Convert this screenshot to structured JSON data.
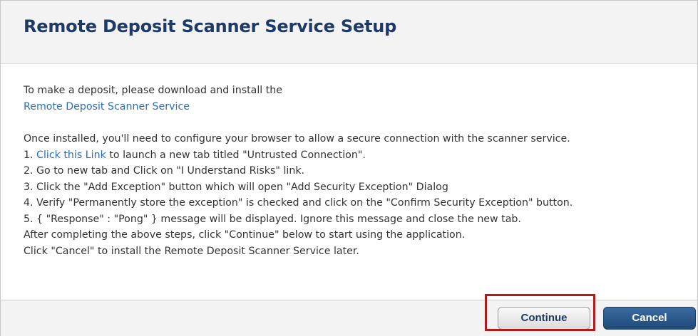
{
  "dialog": {
    "title": "Remote Deposit Scanner Service Setup",
    "intro_line": "To make a deposit, please download and install the",
    "download_link": "Remote Deposit Scanner Service",
    "configure_line": "Once installed, you'll need to configure your browser to allow a secure connection with the scanner service.",
    "step1_prefix": "1. ",
    "step1_link": "Click this Link",
    "step1_suffix": " to launch a new tab titled \"Untrusted Connection\".",
    "step2": "2. Go to new tab and Click on \"I Understand Risks\" link.",
    "step3": "3. Click the \"Add Exception\" button which will open \"Add Security Exception\" Dialog",
    "step4": "4. Verify \"Permanently store the exception\" is checked and click on the \"Confirm Security Exception\" button.",
    "step5": "5. { \"Response\" : \"Pong\" } message will be displayed. Ignore this message and close the new tab.",
    "after_line": "After completing the above steps, click \"Continue\" below to start using the application.",
    "cancel_line": "Click \"Cancel\" to install the Remote Deposit Scanner Service later."
  },
  "buttons": {
    "continue_label": "Continue",
    "cancel_label": "Cancel"
  },
  "colors": {
    "title": "#1d3b66",
    "link": "#2a6fb7",
    "highlight_box": "#b01b1b",
    "cancel_button": "#2a5a8c"
  }
}
